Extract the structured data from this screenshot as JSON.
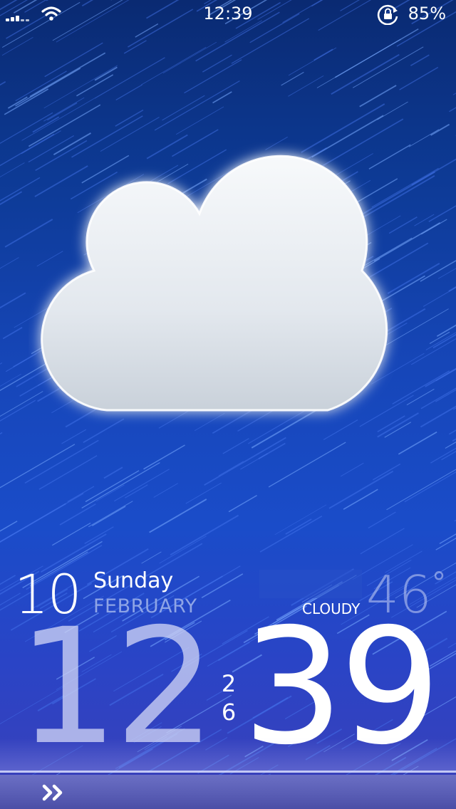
{
  "status_bar": {
    "time": "12:39",
    "battery": "85%",
    "signal_icon": "signal-bars-icon",
    "wifi_icon": "wifi-icon",
    "lock_icon": "rotation-lock-icon"
  },
  "weather": {
    "icon": "cloud-icon",
    "condition": "CLOUDY",
    "temperature": "46",
    "degree": "°"
  },
  "date": {
    "day": "10",
    "weekday": "Sunday",
    "month": "FEBRUARY"
  },
  "clock": {
    "hours": "12",
    "minutes": "39",
    "seconds_tens": "2",
    "seconds_ones": "6"
  },
  "slider": {
    "icon": "double-chevron-right-icon"
  },
  "colors": {
    "background_top": "#0a2a72",
    "background_bottom": "#3b3fb8",
    "month_text": "#8ea4e6",
    "slider_bar": "#585cb4"
  }
}
